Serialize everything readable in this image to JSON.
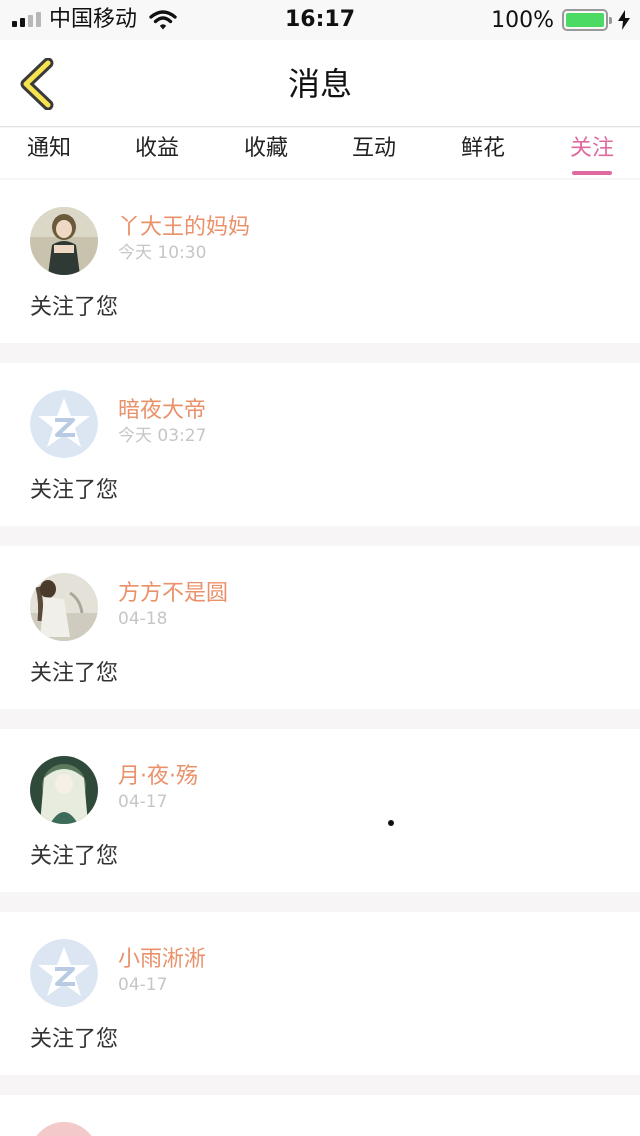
{
  "status_bar": {
    "carrier": "中国移动",
    "time": "16:17",
    "battery_percent": "100%",
    "battery_level": 1.0,
    "signal_bars_filled": 2,
    "signal_bars_total": 4
  },
  "header": {
    "title": "消息",
    "back_icon": "chevron-left-icon"
  },
  "tabs": [
    {
      "label": "通知",
      "active": false
    },
    {
      "label": "收益",
      "active": false
    },
    {
      "label": "收藏",
      "active": false
    },
    {
      "label": "互动",
      "active": false
    },
    {
      "label": "鲜花",
      "active": false
    },
    {
      "label": "关注",
      "active": true
    }
  ],
  "feed": [
    {
      "name": "丫大王的妈妈",
      "time": "今天 10:30",
      "text": "关注了您",
      "avatar": "photo-avatar"
    },
    {
      "name": "暗夜大帝",
      "time": "今天 03:27",
      "text": "关注了您",
      "avatar": "default-avatar"
    },
    {
      "name": "方方不是圆",
      "time": "04-18",
      "text": "关注了您",
      "avatar": "photo-avatar"
    },
    {
      "name": "月·夜·殇",
      "time": "04-17",
      "text": "关注了您",
      "avatar": "photo-avatar"
    },
    {
      "name": "小雨淅淅",
      "time": "04-17",
      "text": "关注了您",
      "avatar": "default-avatar"
    }
  ],
  "colors": {
    "accent": "#e06aa0",
    "username": "#e9916a",
    "timestamp": "#c6c6c6",
    "battery": "#4cd964",
    "default_avatar_bg": "#dce6f3"
  }
}
